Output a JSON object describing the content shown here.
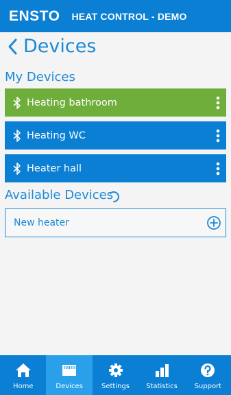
{
  "header": {
    "logo": "ENSTO",
    "title": "HEAT CONTROL - DEMO"
  },
  "back": {
    "label": "Devices"
  },
  "my_devices": {
    "heading": "My Devices",
    "items": [
      {
        "label": "Heating bathroom",
        "color": "#6fae3a",
        "icon": "bluetooth-icon"
      },
      {
        "label": "Heating WC",
        "color": "#0a7fd3",
        "icon": "bluetooth-icon"
      },
      {
        "label": "Heater hall",
        "color": "#0a7fd3",
        "icon": "bluetooth-icon"
      }
    ]
  },
  "available_devices": {
    "heading": "Available Devices",
    "items": [
      {
        "label": "New heater",
        "icon": "add-circle-icon"
      }
    ]
  },
  "nav": {
    "items": [
      {
        "label": "Home",
        "icon": "home-icon",
        "active": false
      },
      {
        "label": "Devices",
        "icon": "devices-icon",
        "active": true
      },
      {
        "label": "Settings",
        "icon": "gear-icon",
        "active": false
      },
      {
        "label": "Statistics",
        "icon": "bar-chart-icon",
        "active": false
      },
      {
        "label": "Support",
        "icon": "help-icon",
        "active": false
      }
    ]
  },
  "colors": {
    "primary": "#0a7fd3",
    "accent_green": "#6fae3a",
    "text_blue": "#1c8ad6",
    "active_nav": "#2aa0ea"
  }
}
